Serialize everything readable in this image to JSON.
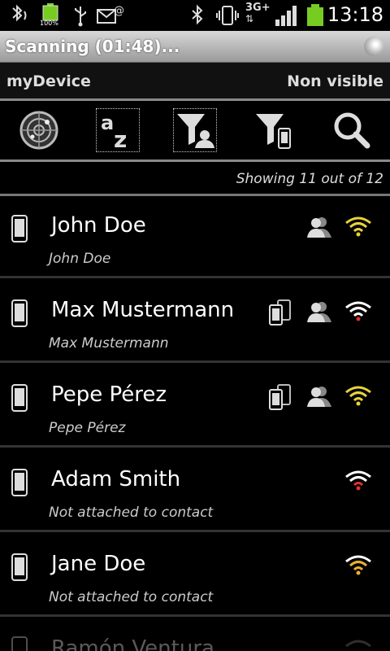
{
  "status_bar": {
    "battery_percent": "100%",
    "network": "3G+",
    "clock": "13:18"
  },
  "title_bar": {
    "title": "Scanning (01:48)..."
  },
  "device_bar": {
    "name": "myDevice",
    "visibility": "Non visible"
  },
  "toolbar": {
    "items": [
      {
        "icon": "radar-icon",
        "selected": false
      },
      {
        "icon": "sort-az-icon",
        "selected": true
      },
      {
        "icon": "filter-contacts-icon",
        "selected": true
      },
      {
        "icon": "filter-phones-icon",
        "selected": false
      },
      {
        "icon": "search-icon",
        "selected": false
      }
    ]
  },
  "summary": {
    "showing": "Showing 11 out of 12"
  },
  "devices": [
    {
      "name": "John Doe",
      "subtitle": "John Doe",
      "signal_color": "#e8d23a",
      "icons": [
        "contact"
      ]
    },
    {
      "name": "Max Mustermann",
      "subtitle": "Max Mustermann",
      "signal_color": "#e03030",
      "icons": [
        "paired",
        "contact"
      ]
    },
    {
      "name": "Pepe Pérez",
      "subtitle": "Pepe Pérez",
      "signal_color": "#e8d23a",
      "icons": [
        "paired",
        "contact"
      ]
    },
    {
      "name": "Adam Smith",
      "subtitle": "Not attached to contact",
      "signal_color": "#e03030",
      "icons": []
    },
    {
      "name": "Jane Doe",
      "subtitle": "Not attached to contact",
      "signal_color": "#e8b030",
      "icons": []
    },
    {
      "name": "Ramón Ventura",
      "subtitle": "",
      "signal_color": "#888888",
      "icons": []
    }
  ]
}
